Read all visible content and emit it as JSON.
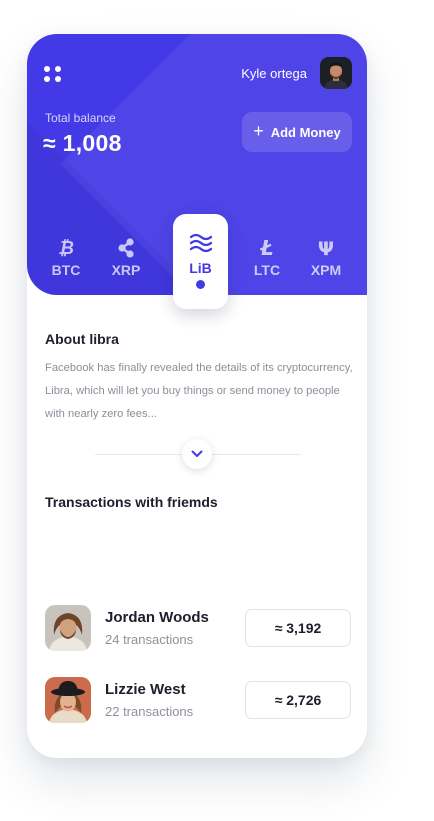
{
  "header": {
    "user_name": "Kyle ortega",
    "balance_label": "Total balance",
    "balance_value": "≈ 1,008",
    "add_money_label": "Add Money"
  },
  "coins": [
    {
      "symbol": "bitcoin-icon",
      "label": "BTC"
    },
    {
      "symbol": "ripple-icon",
      "label": "XRP"
    },
    {
      "symbol": "libra-icon",
      "label": "LiB",
      "active": true
    },
    {
      "symbol": "litecoin-icon",
      "label": "LTC"
    },
    {
      "symbol": "psi-icon",
      "label": "XPM"
    }
  ],
  "about": {
    "title": "About libra",
    "text": "Facebook has finally revealed the details of its cryptocurrency, Libra, which will let you buy things or send money to people with nearly zero fees..."
  },
  "transactions": {
    "title": "Transactions with friemds",
    "items": [
      {
        "name": "Jordan Woods",
        "count": "24 transactions",
        "amount": "≈ 3,192"
      },
      {
        "name": "Lizzie West",
        "count": "22 transactions",
        "amount": "≈ 2,726"
      }
    ]
  },
  "colors": {
    "accent": "#4339e6"
  }
}
